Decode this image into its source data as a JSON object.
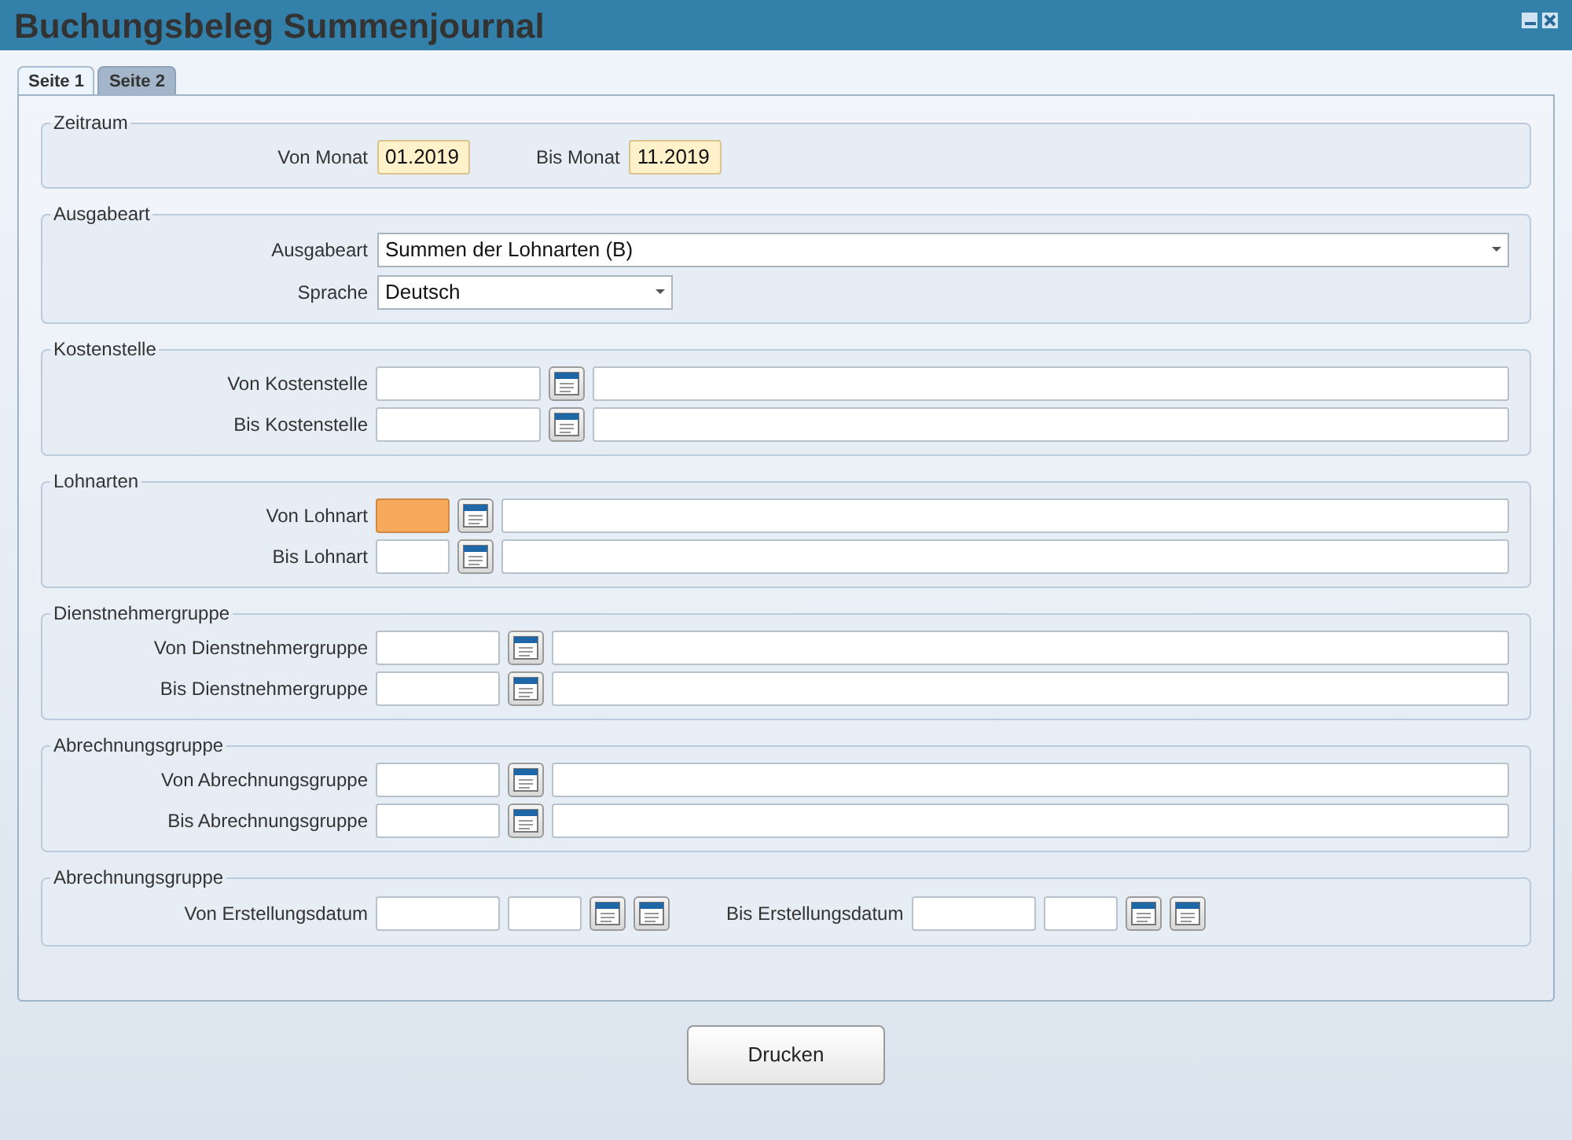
{
  "window": {
    "title": "Buchungsbeleg Summenjournal"
  },
  "tabs": [
    {
      "label": "Seite 1",
      "selected": true
    },
    {
      "label": "Seite 2",
      "selected": false
    }
  ],
  "sections": [
    {
      "title": "Zeitraum",
      "rows": [
        {
          "kind": "range",
          "fields": [
            {
              "label": "Von Monat",
              "value": "01.2019"
            },
            {
              "label": "Bis Monat",
              "value": "11.2019"
            }
          ]
        }
      ]
    },
    {
      "title": "Ausgabeart",
      "rows": [
        {
          "kind": "select",
          "label": "Ausgabeart",
          "value": "Summen der Lohnarten (B)"
        },
        {
          "kind": "select",
          "label": "Sprache",
          "value": "Deutsch"
        }
      ]
    },
    {
      "title": "Kostenstelle",
      "rows": [
        {
          "kind": "lookup",
          "label": "Von Kostenstelle",
          "focused": false
        },
        {
          "kind": "lookup",
          "label": "Bis Kostenstelle",
          "focused": false
        }
      ]
    },
    {
      "title": "Lohnarten",
      "rows": [
        {
          "kind": "lookup",
          "label": "Von Lohnart",
          "focused": true
        },
        {
          "kind": "lookup",
          "label": "Bis Lohnart",
          "focused": false
        }
      ]
    },
    {
      "title": "Dienstnehmergruppe",
      "rows": [
        {
          "kind": "lookup",
          "label": "Von Dienstnehmergruppe",
          "focused": false
        },
        {
          "kind": "lookup",
          "label": "Bis Dienstnehmergruppe",
          "focused": false
        }
      ]
    },
    {
      "title": "Abrechnungsgruppe",
      "rows": [
        {
          "kind": "lookup",
          "label": "Von Abrechnungsgruppe",
          "focused": false
        },
        {
          "kind": "lookup",
          "label": "Bis Abrechnungsgruppe",
          "focused": false
        }
      ]
    },
    {
      "title": "Abrechnungsgruppe",
      "rows": [
        {
          "kind": "dates",
          "fields": [
            {
              "label": "Von Erstellungsdatum"
            },
            {
              "label": "Bis Erstellungsdatum"
            }
          ]
        }
      ]
    }
  ],
  "buttons": [
    {
      "label": "Drucken"
    }
  ]
}
